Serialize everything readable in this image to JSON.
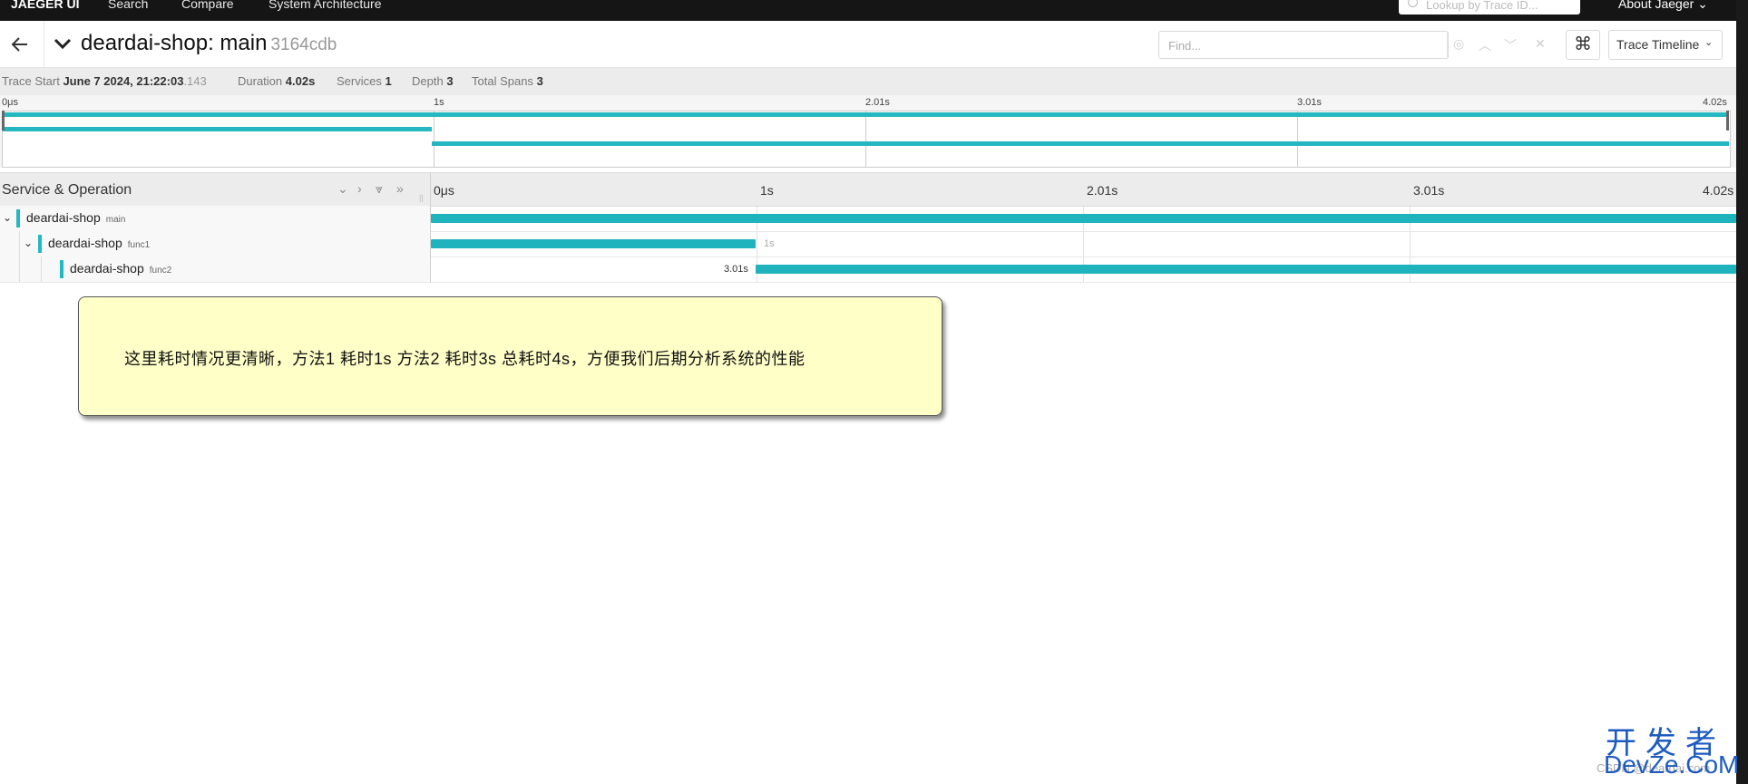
{
  "nav": {
    "brand": "JAEGER UI",
    "links": [
      "Search",
      "Compare",
      "System Architecture"
    ],
    "lookup_placeholder": "Lookup by Trace ID...",
    "about": "About Jaeger"
  },
  "header": {
    "service": "deardai-shop: main",
    "trace_id": "3164cdb",
    "find_placeholder": "Find...",
    "view_mode": "Trace Timeline"
  },
  "stats": {
    "trace_start_label": "Trace Start",
    "trace_start_value": "June 7 2024, 21:22:03",
    "trace_start_ms": ".143",
    "duration_label": "Duration",
    "duration_value": "4.02s",
    "services_label": "Services",
    "services_value": "1",
    "depth_label": "Depth",
    "depth_value": "3",
    "spans_label": "Total Spans",
    "spans_value": "3"
  },
  "minimap": {
    "ticks": [
      "0μs",
      "1s",
      "2.01s",
      "3.01s",
      "4.02s"
    ]
  },
  "table": {
    "column_label": "Service & Operation",
    "ticks": [
      "0μs",
      "1s",
      "2.01s",
      "3.01s",
      "4.02s"
    ]
  },
  "spans": [
    {
      "service": "deardai-shop",
      "operation": "main",
      "start_s": 0,
      "duration_s": 4.02,
      "duration_label": ""
    },
    {
      "service": "deardai-shop",
      "operation": "func1",
      "start_s": 0,
      "duration_s": 1.0,
      "duration_label": "1s"
    },
    {
      "service": "deardai-shop",
      "operation": "func2",
      "start_s": 1.0,
      "duration_s": 3.02,
      "duration_label": "3.01s"
    }
  ],
  "annotation": "这里耗时情况更清晰，方法1 耗时1s 方法2 耗时3s  总耗时4s，方便我们后期分析系统的性能",
  "watermark": {
    "line1": "开发者",
    "line2": "DevZe.CoM",
    "line3": "CSDN @deardai.com"
  },
  "colors": {
    "span": "#1fb3bd",
    "topnav": "#151515",
    "note_bg": "#ffffc8"
  }
}
